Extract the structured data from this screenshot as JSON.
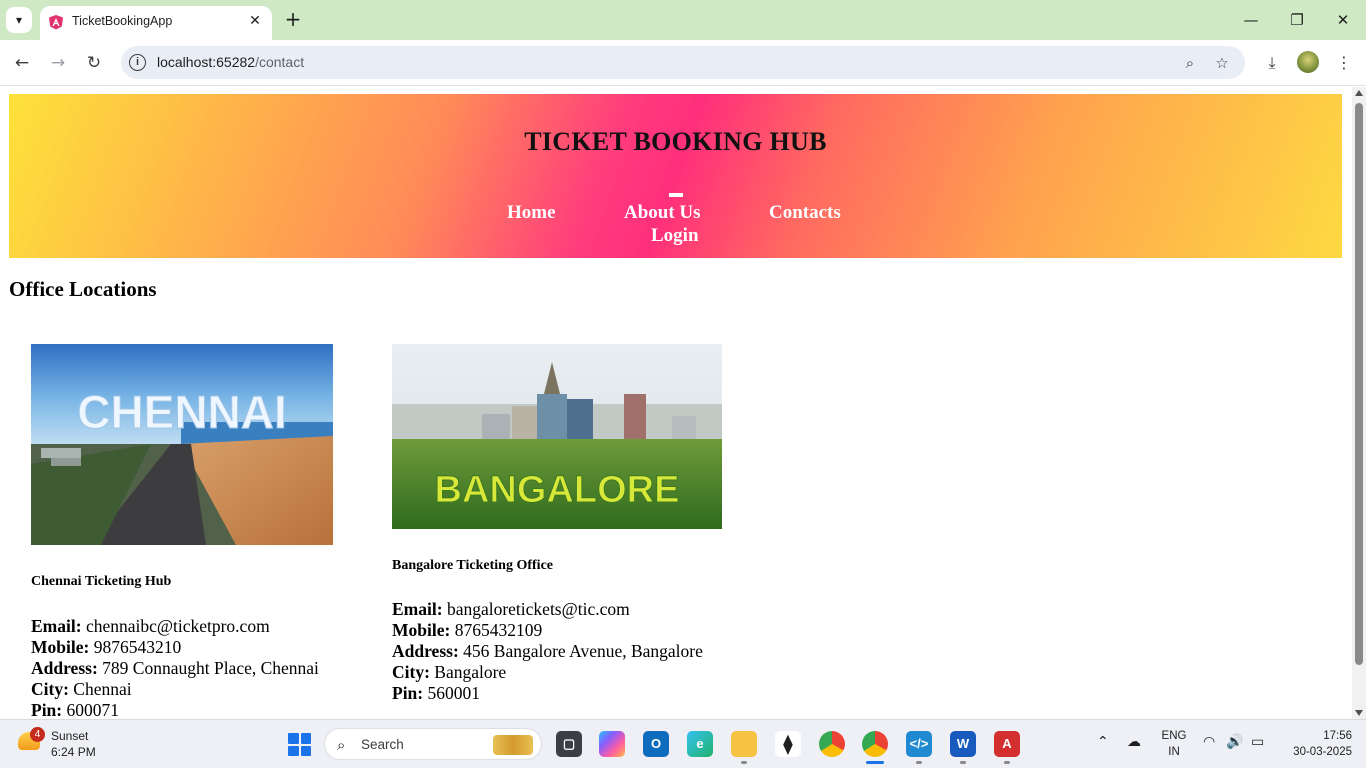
{
  "browser": {
    "tab_title": "TicketBookingApp",
    "url_host": "localhost:65282",
    "url_path": "/contact",
    "tab_close": "✕",
    "new_tab": "+",
    "minimize": "—",
    "restore": "❐",
    "close": "✕"
  },
  "site": {
    "brand": "TICKET BOOKING HUB",
    "nav": {
      "home": "Home",
      "about": "About Us",
      "contacts": "Contacts",
      "login": "Login"
    },
    "section_title": "Office Locations",
    "offices": [
      {
        "image_text": "CHENNAI",
        "name": "Chennai Ticketing Hub",
        "email_label": "Email:",
        "email": "chennaibc@ticketpro.com",
        "mobile_label": "Mobile:",
        "mobile": "9876543210",
        "address_label": "Address:",
        "address": "789 Connaught Place, Chennai",
        "city_label": "City:",
        "city": "Chennai",
        "pin_label": "Pin:",
        "pin": "600071"
      },
      {
        "image_text": "BANGALORE",
        "name": "Bangalore Ticketing Office",
        "email_label": "Email:",
        "email": "bangaloretickets@tic.com",
        "mobile_label": "Mobile:",
        "mobile": "8765432109",
        "address_label": "Address:",
        "address": "456 Bangalore Avenue, Bangalore",
        "city_label": "City:",
        "city": "Bangalore",
        "pin_label": "Pin:",
        "pin": "560001"
      }
    ]
  },
  "taskbar": {
    "weather_badge": "4",
    "weather_title": "Sunset",
    "weather_time": "6:24 PM",
    "search_placeholder": "Search",
    "lang_1": "ENG",
    "lang_2": "IN",
    "clock_time": "17:56",
    "clock_date": "30-03-2025"
  }
}
